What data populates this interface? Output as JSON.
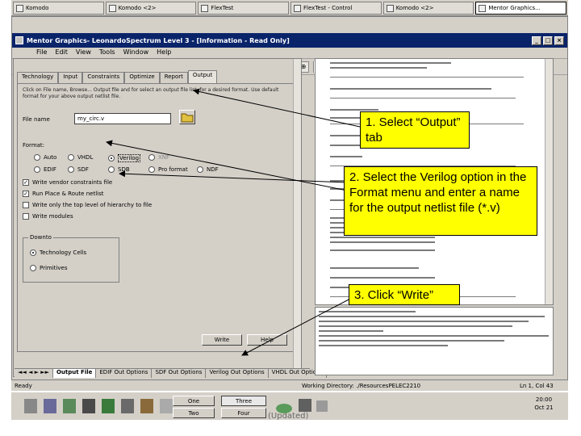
{
  "taskbar_top": {
    "items": [
      "Komodo",
      "Komodo <2>",
      "FlexTest",
      "FlexTest - Control",
      "Komodo <2>",
      "Mentor Graphics..."
    ]
  },
  "window": {
    "title": "Mentor Graphics- LeonardoSpectrum Level 3 - [Information - Read Only]",
    "menu": [
      "File",
      "Edit",
      "View",
      "Tools",
      "Window",
      "Help"
    ]
  },
  "tabs": [
    "Technology",
    "Input",
    "Constraints",
    "Optimize",
    "Report",
    "Output"
  ],
  "output_panel": {
    "description": "Click on File name, Browse... Output file and for select an output file list, for a desired format. Use default format for your above output netlist file.",
    "file_name_label": "File name",
    "file_name_value": "my_circ.v",
    "format_label": "Format:",
    "formats_row1": [
      "Auto",
      "VHDL",
      "Verilog",
      "XNF"
    ],
    "formats_row2": [
      "EDIF",
      "SDF",
      "SDB",
      "Pro format",
      "NDF"
    ],
    "checkboxes": [
      "Write vendor constraints file",
      "Run Place & Route netlist",
      "Write only the top level of hierarchy to file",
      "Write modules"
    ],
    "checkbox_states": [
      true,
      true,
      false,
      false
    ],
    "downto_label": "Downto",
    "downto_options": [
      "Technology Cells",
      "Primitives"
    ],
    "write_button": "Write",
    "help_button": "Help"
  },
  "bottom_tabs": [
    "Output File",
    "EDIF Out Options",
    "SDF Out Options",
    "Verilog Out Options",
    "VHDL Out Options"
  ],
  "status": {
    "left": "Ready",
    "middle": "Working Directory: ./ResourcesPELEC2210",
    "right": "Ln 1, Col 43"
  },
  "taskbar_bottom": {
    "items": [
      "One",
      "Three",
      "Two",
      "Four"
    ],
    "caption": "(Updated)",
    "time": "20:00",
    "date": "Oct 21"
  },
  "callouts": {
    "step1": "1. Select “Output” tab",
    "step2": "2. Select the Verilog option in the Format menu and enter a name for the output netlist file (*.v)",
    "step3": "3. Click “Write”"
  },
  "icons": {
    "folder": "folder-icon",
    "close": "close-icon",
    "minimize": "minimize-icon",
    "maximize": "maximize-icon"
  },
  "colors": {
    "callout_bg": "#ffff00",
    "titlebar": "#0a246a",
    "window_bg": "#d4d0c8"
  }
}
